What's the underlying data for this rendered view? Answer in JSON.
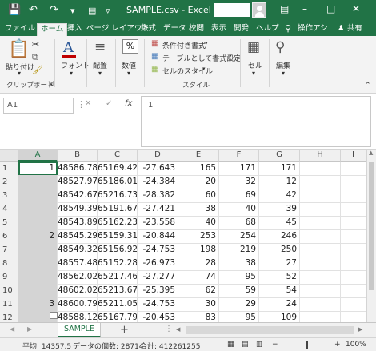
{
  "titlebar": {
    "save_icon": "save-icon",
    "undo_icon": "undo-icon",
    "redo_icon": "redo-icon",
    "title": "SAMPLE.csv  -  Excel",
    "minimize": "–",
    "maximize": "□",
    "close": "✕"
  },
  "tabs": [
    "ファイル",
    "ホーム",
    "挿入",
    "ページ レイアウト",
    "数式",
    "データ",
    "校閲",
    "表示",
    "開発",
    "ヘルプ",
    "操作アシ",
    "共有"
  ],
  "ribbon": {
    "paste": "貼り付け",
    "clipboard": "クリップボード",
    "font": "フォント",
    "align": "配置",
    "number": "数値",
    "percent": "%",
    "conditional": "条件付き書式",
    "table": "テーブルとして書式設定",
    "cellstyle": "セルのスタイル",
    "style": "スタイル",
    "cells": "セル",
    "edit": "編集"
  },
  "formula": {
    "namebox": "A1",
    "cancel": "✕",
    "enter": "✓",
    "fx": "fx",
    "content": "1"
  },
  "columns": [
    "A",
    "B",
    "C",
    "D",
    "E",
    "F",
    "G",
    "H",
    "I"
  ],
  "rows": [
    {
      "n": "1",
      "a": "1",
      "b": "48586.78",
      "c": "65169.42",
      "d": "-27.643",
      "e": "165",
      "f": "171",
      "g": "171"
    },
    {
      "n": "2",
      "a": "",
      "b": "48527.97",
      "c": "65186.01",
      "d": "-24.384",
      "e": "20",
      "f": "32",
      "g": "12"
    },
    {
      "n": "3",
      "a": "",
      "b": "48542.67",
      "c": "65216.73",
      "d": "-28.382",
      "e": "60",
      "f": "69",
      "g": "42"
    },
    {
      "n": "4",
      "a": "",
      "b": "48549.39",
      "c": "65191.67",
      "d": "-27.421",
      "e": "38",
      "f": "40",
      "g": "39"
    },
    {
      "n": "5",
      "a": "",
      "b": "48543.89",
      "c": "65162.23",
      "d": "-23.558",
      "e": "40",
      "f": "68",
      "g": "45"
    },
    {
      "n": "6",
      "a": "2",
      "b": "48545.29",
      "c": "65159.31",
      "d": "-20.844",
      "e": "253",
      "f": "254",
      "g": "246"
    },
    {
      "n": "7",
      "a": "",
      "b": "48549.32",
      "c": "65156.92",
      "d": "-24.753",
      "e": "198",
      "f": "219",
      "g": "250"
    },
    {
      "n": "8",
      "a": "",
      "b": "48557.48",
      "c": "65152.28",
      "d": "-26.973",
      "e": "28",
      "f": "38",
      "g": "27"
    },
    {
      "n": "9",
      "a": "",
      "b": "48562.02",
      "c": "65217.46",
      "d": "-27.277",
      "e": "74",
      "f": "95",
      "g": "52"
    },
    {
      "n": "10",
      "a": "",
      "b": "48602.02",
      "c": "65213.67",
      "d": "-25.395",
      "e": "62",
      "f": "59",
      "g": "54"
    },
    {
      "n": "11",
      "a": "3",
      "b": "48600.79",
      "c": "65211.05",
      "d": "-24.753",
      "e": "30",
      "f": "29",
      "g": "24"
    },
    {
      "n": "12",
      "a": "",
      "b": "48588.12",
      "c": "65167.79",
      "d": "-20.453",
      "e": "83",
      "f": "95",
      "g": "109"
    }
  ],
  "sheet": {
    "name": "SAMPLE",
    "add": "+"
  },
  "status": {
    "avg": "平均: 14357.5",
    "count": "データの個数: 28714",
    "sum": "合計: 412261255",
    "zoom": "100%"
  },
  "colors": {
    "accent": "#217346"
  }
}
